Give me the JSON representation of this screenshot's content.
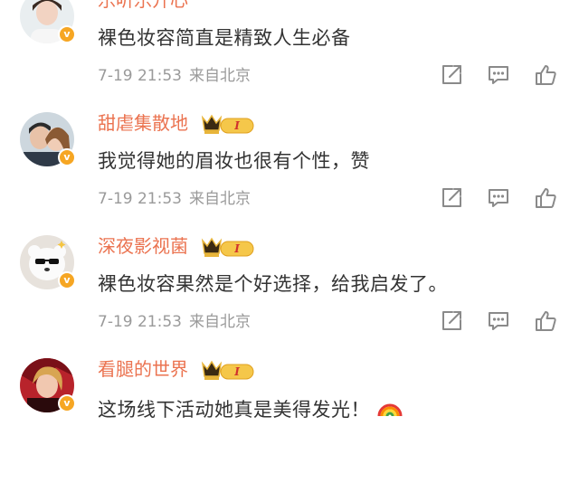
{
  "comments": [
    {
      "username": "乐听乐开心",
      "text": "裸色妆容简直是精致人生必备",
      "time": "7-19 21:53",
      "source": "来自北京",
      "verified": "v"
    },
    {
      "username": "甜虐集散地",
      "text": "我觉得她的眉妆也很有个性，赞",
      "time": "7-19 21:53",
      "source": "来自北京",
      "verified": "v",
      "member_level": "I"
    },
    {
      "username": "深夜影视菌",
      "text": "裸色妆容果然是个好选择，给我启发了。",
      "time": "7-19 21:53",
      "source": "来自北京",
      "verified": "v",
      "member_level": "I"
    },
    {
      "username": "看腿的世界",
      "text": "这场线下活动她真是美得发光！",
      "emoji": "rainbow-icon",
      "verified": "v",
      "member_level": "I"
    }
  ],
  "colors": {
    "username": "#eb7350",
    "verified_badge": "#f6a623",
    "meta_text": "#9a9a9a",
    "body_text": "#333333"
  }
}
